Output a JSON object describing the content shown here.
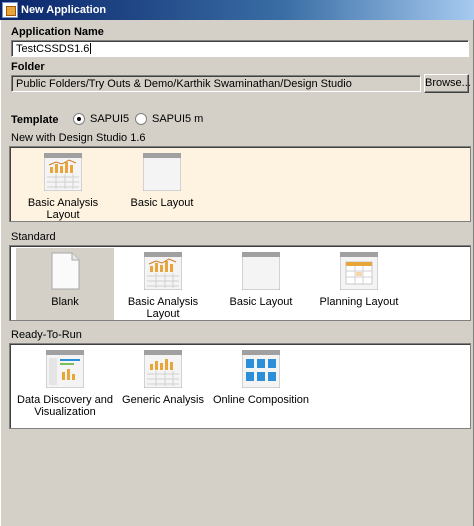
{
  "window": {
    "title": "New Application"
  },
  "form": {
    "app_name_label": "Application Name",
    "app_name_value": "TestCSSDS1.6",
    "folder_label": "Folder",
    "folder_value": "Public Folders/Try Outs & Demo/Karthik Swaminathan/Design Studio",
    "browse_label": "Browse...",
    "template_label": "Template",
    "template_options": [
      {
        "label": "SAPUI5",
        "selected": true
      },
      {
        "label": "SAPUI5 m",
        "selected": false
      }
    ]
  },
  "sections": {
    "ds16": {
      "title": "New with Design Studio 1.6",
      "tiles": [
        {
          "label": "Basic Analysis Layout",
          "icon": "basic-analysis-layout-icon"
        },
        {
          "label": "Basic Layout",
          "icon": "basic-layout-icon"
        }
      ]
    },
    "standard": {
      "title": "Standard",
      "tiles": [
        {
          "label": "Blank",
          "icon": "blank-document-icon",
          "selected": true
        },
        {
          "label": "Basic Analysis Layout",
          "icon": "basic-analysis-layout-icon"
        },
        {
          "label": "Basic Layout",
          "icon": "basic-layout-icon"
        },
        {
          "label": "Planning Layout",
          "icon": "planning-layout-icon"
        }
      ]
    },
    "ready": {
      "title": "Ready-To-Run",
      "tiles": [
        {
          "label": "Data Discovery and Visualization",
          "icon": "data-discovery-icon"
        },
        {
          "label": "Generic Analysis",
          "icon": "generic-analysis-icon"
        },
        {
          "label": "Online Composition",
          "icon": "online-composition-icon"
        }
      ]
    }
  },
  "colors": {
    "selected_gallery_bg": "#fdf3e0",
    "tile_header_gray": "#a0a0a0",
    "chart_orange": "#e8a53a",
    "composition_blue": "#2c8fd8"
  }
}
